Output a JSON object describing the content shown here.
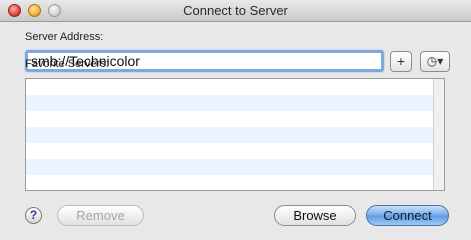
{
  "window": {
    "title": "Connect to Server"
  },
  "server_address": {
    "label": "Server Address:",
    "value": "smb://Technicolor",
    "add_label": "+",
    "recent_label": "◷▾"
  },
  "favorites": {
    "label": "Favorite Servers:",
    "items": []
  },
  "footer": {
    "help_label": "?",
    "remove_label": "Remove",
    "browse_label": "Browse",
    "connect_label": "Connect"
  }
}
